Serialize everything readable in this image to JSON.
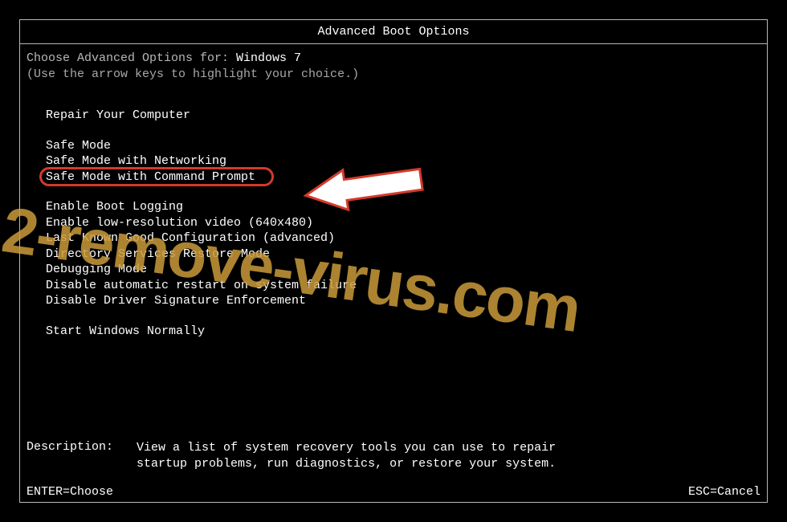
{
  "title": "Advanced Boot Options",
  "prompt": {
    "choose_label": "Choose Advanced Options for: ",
    "os_name": "Windows 7",
    "instruction": "(Use the arrow keys to highlight your choice.)"
  },
  "menu": {
    "repair": "Repair Your Computer",
    "group2": [
      "Safe Mode",
      "Safe Mode with Networking",
      "Safe Mode with Command Prompt"
    ],
    "group3": [
      "Enable Boot Logging",
      "Enable low-resolution video (640x480)",
      "Last Known Good Configuration (advanced)",
      "Directory Services Restore Mode",
      "Debugging Mode",
      "Disable automatic restart on system failure",
      "Disable Driver Signature Enforcement"
    ],
    "start_normally": "Start Windows Normally"
  },
  "description": {
    "label": "Description:",
    "text": "View a list of system recovery tools you can use to repair startup problems, run diagnostics, or restore your system."
  },
  "footer": {
    "enter": "ENTER=Choose",
    "esc": "ESC=Cancel"
  },
  "watermark": "2-remove-virus.com"
}
